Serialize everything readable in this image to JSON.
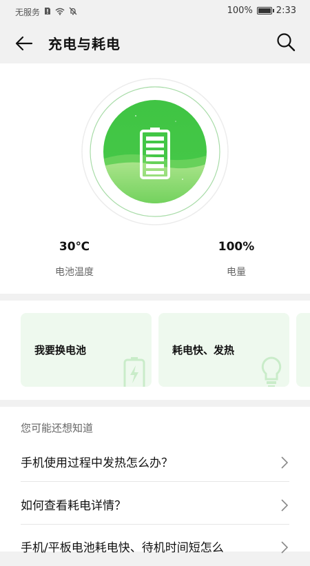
{
  "status_bar": {
    "carrier": "无服务",
    "battery_percent": "100%",
    "time": "2:33"
  },
  "header": {
    "title": "充电与耗电"
  },
  "battery": {
    "temperature": "30℃",
    "temperature_label": "电池温度",
    "level": "100%",
    "level_label": "电量",
    "accent_color": "#44c845"
  },
  "quick_actions": [
    {
      "label": "我要换电池",
      "icon": "battery-charging-icon"
    },
    {
      "label": "耗电快、发热",
      "icon": "lightbulb-icon"
    },
    {
      "label": "",
      "icon": ""
    }
  ],
  "faq": {
    "heading": "您可能还想知道",
    "items": [
      {
        "question": "手机使用过程中发热怎么办？"
      },
      {
        "question": "如何查看耗电详情？"
      },
      {
        "question": "手机/平板电池耗电快、待机时间短怎么"
      }
    ]
  }
}
